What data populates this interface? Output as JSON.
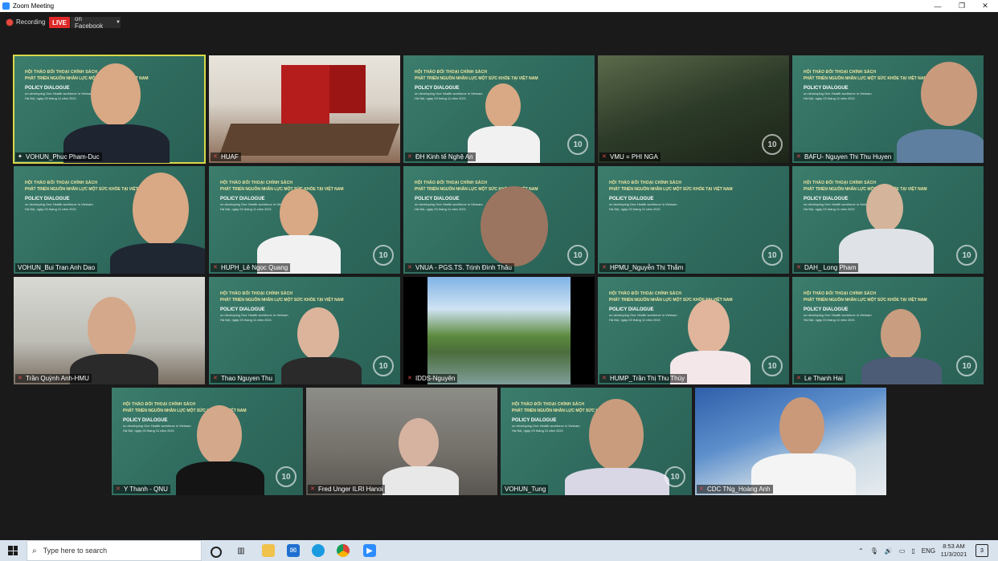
{
  "window": {
    "title": "Zoom Meeting",
    "min_label": "—",
    "max_label": "❐",
    "close_label": "✕"
  },
  "meeting": {
    "recording_label": "Recording",
    "live_label": "LIVE",
    "stream_label": "on Facebook"
  },
  "slide": {
    "line1": "HỘI THẢO ĐỐI THOẠI CHÍNH SÁCH",
    "line2": "PHÁT TRIỂN NGUỒN NHÂN LỰC MỘT SỨC KHỎE TẠI VIỆT NAM",
    "line3": "POLICY DIALOGUE",
    "line4": "on developing One Health workforce in Vietnam",
    "line5": "Hà Nội, ngày 03 tháng 11 năm 2021",
    "logo": "10"
  },
  "participants": [
    {
      "name": "VOHUN_Phuc Pham-Duc",
      "muted": false,
      "pinned": true,
      "active": true
    },
    {
      "name": "HUAF",
      "muted": true
    },
    {
      "name": "ĐH Kinh tế Nghệ An",
      "muted": true
    },
    {
      "name": "VMU = PHI NGA",
      "muted": true
    },
    {
      "name": "BAFU- Nguyen Thi Thu Huyen",
      "muted": true
    },
    {
      "name": "VOHUN_Bui Tran Anh Dao",
      "muted": false
    },
    {
      "name": "HUPH_Lê Ngọc Quang",
      "muted": true
    },
    {
      "name": "VNUA - PGS.TS. Trịnh Đình Thâu",
      "muted": true
    },
    {
      "name": "HPMU_Nguyễn Thị Thắm",
      "muted": true
    },
    {
      "name": "DAH_ Long Pham",
      "muted": true
    },
    {
      "name": "Trần Quỳnh Anh-HMU",
      "muted": true
    },
    {
      "name": "Thao Nguyen Thu",
      "muted": true
    },
    {
      "name": "IDDS-Nguyên",
      "muted": true
    },
    {
      "name": "HUMP_Trần Thị Thu Thúy",
      "muted": true
    },
    {
      "name": "Le Thanh Hai",
      "muted": true
    },
    {
      "name": "Y Thanh - QNU",
      "muted": true
    },
    {
      "name": "Fred Unger ILRI Hanoi",
      "muted": true
    },
    {
      "name": "VOHUN_Tung",
      "muted": false
    },
    {
      "name": "CDC TNg_Hoàng Anh",
      "muted": true
    }
  ],
  "taskbar": {
    "search_placeholder": "Type here to search",
    "language": "ENG",
    "time": "8:53 AM",
    "date": "11/3/2021",
    "notifications": "3",
    "icons": [
      "windows-icon",
      "cortana-icon",
      "task-view-icon",
      "file-explorer-icon",
      "mail-icon",
      "edge-icon",
      "chrome-icon",
      "zoom-icon"
    ]
  },
  "colors": {
    "slide_green": "#2f6b5e",
    "live_red": "#e02828",
    "active_border": "#d8d84a",
    "taskbar": "#d9e3ee"
  }
}
